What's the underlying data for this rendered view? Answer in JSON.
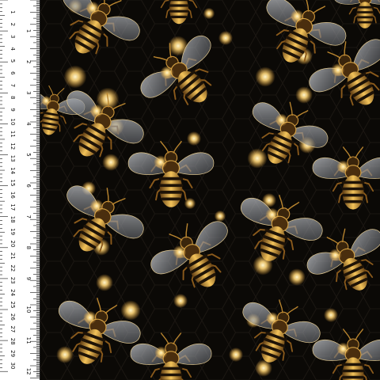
{
  "image": {
    "kind": "seamless fabric print preview",
    "motif": "metallic gold bees with bokeh lights on black honeycomb background"
  },
  "ruler": {
    "unit_major": "cm",
    "unit_minor": "in",
    "cm_labels": [
      "1",
      "2",
      "3",
      "4",
      "5",
      "6",
      "7",
      "8",
      "9",
      "10",
      "11",
      "12",
      "13",
      "14",
      "15",
      "16",
      "17",
      "18",
      "19",
      "20",
      "21",
      "22",
      "23",
      "24",
      "25",
      "26",
      "27",
      "28",
      "29",
      "30"
    ],
    "inch_labels": [
      "1",
      "2",
      "3",
      "4",
      "5",
      "6",
      "7",
      "8",
      "9",
      "10",
      "11",
      "12"
    ]
  },
  "colors": {
    "background": "#0b0906",
    "hex_line": "#1d1813",
    "bee_gold": "#d9a441",
    "bee_dark": "#24170a",
    "wing": "#9aa0a8",
    "glow": "#ffd77a"
  }
}
